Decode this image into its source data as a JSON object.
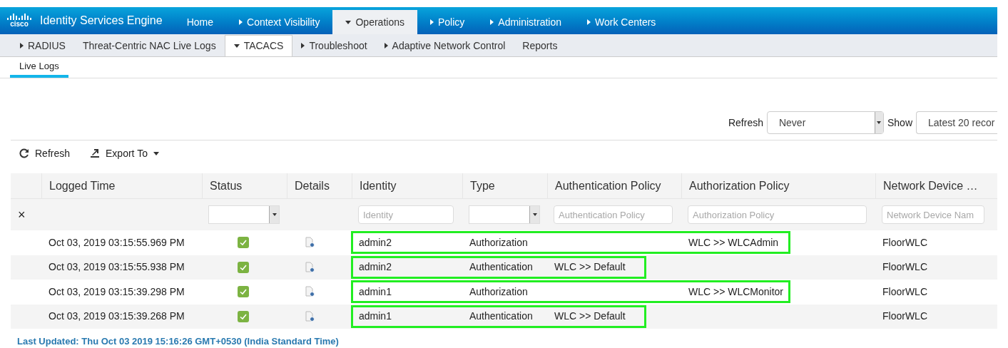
{
  "header": {
    "logo": "cisco",
    "title": "Identity Services Engine",
    "nav": [
      {
        "label": "Home",
        "kind": "plain",
        "selected": false
      },
      {
        "label": "Context Visibility",
        "kind": "collapsed",
        "selected": false
      },
      {
        "label": "Operations",
        "kind": "expanded",
        "selected": true
      },
      {
        "label": "Policy",
        "kind": "collapsed",
        "selected": false
      },
      {
        "label": "Administration",
        "kind": "collapsed",
        "selected": false
      },
      {
        "label": "Work Centers",
        "kind": "collapsed",
        "selected": false
      }
    ]
  },
  "subnav": [
    {
      "label": "RADIUS",
      "kind": "collapsed",
      "selected": false
    },
    {
      "label": "Threat-Centric NAC Live Logs",
      "kind": "plain",
      "selected": false
    },
    {
      "label": "TACACS",
      "kind": "expanded",
      "selected": true
    },
    {
      "label": "Troubleshoot",
      "kind": "collapsed",
      "selected": false
    },
    {
      "label": "Adaptive Network Control",
      "kind": "collapsed",
      "selected": false
    },
    {
      "label": "Reports",
      "kind": "plain",
      "selected": false
    }
  ],
  "tabs": [
    {
      "label": "Live Logs",
      "selected": true
    }
  ],
  "controls": {
    "refresh_label": "Refresh",
    "refresh_value": "Never",
    "show_label": "Show",
    "show_value": "Latest 20 recor"
  },
  "toolbar": [
    {
      "label": "Refresh",
      "kind": "refresh"
    },
    {
      "label": "Export To",
      "kind": "export"
    }
  ],
  "table": {
    "columns": [
      "Logged Time",
      "Status",
      "Details",
      "Identity",
      "Type",
      "Authentication Policy",
      "Authorization Policy",
      "Network Device …"
    ],
    "clear": "×",
    "filters": [
      {
        "kind": "none"
      },
      {
        "kind": "select"
      },
      {
        "kind": "none"
      },
      {
        "kind": "text",
        "placeholder": "Identity"
      },
      {
        "kind": "select"
      },
      {
        "kind": "text",
        "placeholder": "Authentication Policy"
      },
      {
        "kind": "text",
        "placeholder": "Authorization Policy"
      },
      {
        "kind": "text",
        "placeholder": "Network Device Nam"
      }
    ],
    "rows": [
      {
        "logged_time": "Oct 03, 2019 03:15:55.969 PM",
        "passed": true,
        "identity": "admin2",
        "type": "Authorization",
        "authorization_policy": "WLC >> WLCAdmin",
        "network_device": "FloorWLC",
        "kind": "wide"
      },
      {
        "logged_time": "Oct 03, 2019 03:15:55.938 PM",
        "passed": true,
        "identity": "admin2",
        "type": "Authentication",
        "authentication_policy": "WLC >> Default",
        "network_device": "FloorWLC",
        "kind": "narrow"
      },
      {
        "logged_time": "Oct 03, 2019 03:15:39.298 PM",
        "passed": true,
        "identity": "admin1",
        "type": "Authorization",
        "authorization_policy": "WLC >> WLCMonitor",
        "network_device": "FloorWLC",
        "kind": "wide"
      },
      {
        "logged_time": "Oct 03, 2019 03:15:39.268 PM",
        "passed": true,
        "identity": "admin1",
        "type": "Authentication",
        "authentication_policy": "WLC >> Default",
        "network_device": "FloorWLC",
        "kind": "narrow"
      }
    ]
  },
  "footer": "Last Updated: Thu Oct 03 2019 15:16:26 GMT+0530 (India Standard Time)"
}
